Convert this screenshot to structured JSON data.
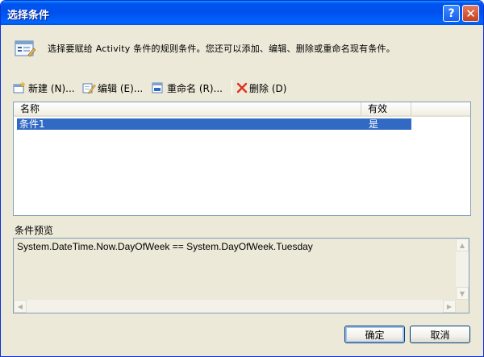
{
  "window": {
    "title": "选择条件"
  },
  "info": {
    "text": "选择要赋给 Activity 条件的规则条件。您还可以添加、编辑、删除或重命名现有条件。"
  },
  "toolbar": {
    "new_label": "新建 (N)...",
    "edit_label": "编辑 (E)...",
    "rename_label": "重命名 (R)...",
    "delete_label": "删除 (D)"
  },
  "list": {
    "columns": [
      "名称",
      "有效"
    ],
    "rows": [
      {
        "name": "条件1",
        "valid": "是"
      }
    ]
  },
  "preview": {
    "label": "条件预览",
    "text": "System.DateTime.Now.DayOfWeek == System.DayOfWeek.Tuesday"
  },
  "buttons": {
    "ok": "确定",
    "cancel": "取消"
  },
  "colors": {
    "titlebar": "#0054e3",
    "selection": "#316ac5",
    "dialog_bg": "#ece9d8",
    "close_button": "#c4401f"
  }
}
